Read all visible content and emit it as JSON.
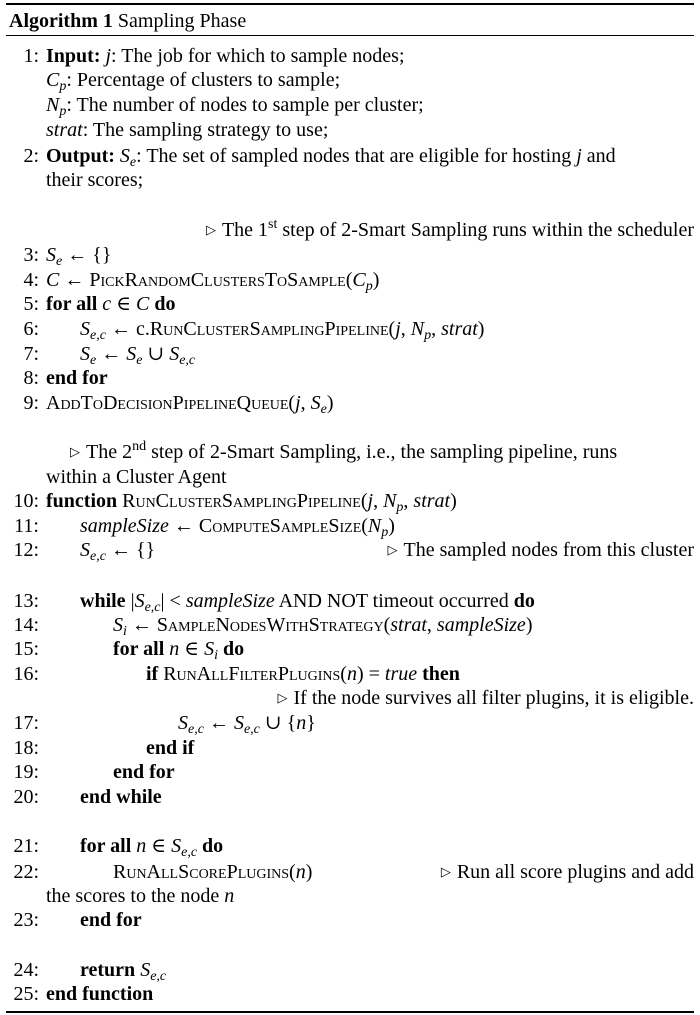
{
  "caption": {
    "label": "Algorithm 1",
    "title": "Sampling Phase"
  },
  "lines": [
    {
      "n": "1:",
      "k": "Input:",
      "t": " j: The job for which to sample nodes;"
    },
    {
      "t": "Cp: Percentage of clusters to sample;"
    },
    {
      "t": "Np: The number of nodes to sample per cluster;"
    },
    {
      "t": "strat: The sampling strategy to use;"
    },
    {
      "n": "2:",
      "k": "Output:",
      "t": " Se: The set of sampled nodes that are eligible for hosting j and"
    },
    {
      "t": "their scores;"
    },
    {
      "c": "The 1st step of 2-Smart Sampling runs within the scheduler"
    },
    {
      "n": "3:",
      "t": "Se ← {}"
    },
    {
      "n": "4:",
      "t": "C ← PickRandomClustersToSample(Cp)"
    },
    {
      "n": "5:",
      "t": "for all c ∈ C do"
    },
    {
      "n": "6:",
      "t": "Se,c ← c.RunClusterSamplingPipeline(j, Np, strat)"
    },
    {
      "n": "7:",
      "t": "Se ← Se ∪ Se,c"
    },
    {
      "n": "8:",
      "t": "end for"
    },
    {
      "n": "9:",
      "t": "AddToDecisionPipelineQueue(j, Se)"
    },
    {
      "c": "The 2nd step of 2-Smart Sampling, i.e., the sampling pipeline, runs"
    },
    {
      "t": "within a Cluster Agent"
    },
    {
      "n": "10:",
      "t": "function RunClusterSamplingPipeline(j, Np, strat)"
    },
    {
      "n": "11:",
      "t": "sampleSize ← ComputeSampleSize(Np)"
    },
    {
      "n": "12:",
      "t": "Se,c ← {}",
      "c": "The sampled nodes from this cluster"
    },
    {
      "n": "13:",
      "t": "while |Se,c| < sampleSize AND NOT timeout occurred do"
    },
    {
      "n": "14:",
      "t": "Si ← SampleNodesWithStrategy(strat, sampleSize)"
    },
    {
      "n": "15:",
      "t": "for all n ∈ Si do"
    },
    {
      "n": "16:",
      "t": "if RunAllFilterPlugins(n) = true then"
    },
    {
      "c": "If the node survives all filter plugins, it is eligible."
    },
    {
      "n": "17:",
      "t": "Se,c ← Se,c ∪ {n}"
    },
    {
      "n": "18:",
      "t": "end if"
    },
    {
      "n": "19:",
      "t": "end for"
    },
    {
      "n": "20:",
      "t": "end while"
    },
    {
      "n": "21:",
      "t": "for all n ∈ Se,c do"
    },
    {
      "n": "22:",
      "t": "RunAllScorePlugins(n)",
      "c": "Run all score plugins and add"
    },
    {
      "t": "the scores to the node n"
    },
    {
      "n": "23:",
      "t": "end for"
    },
    {
      "n": "24:",
      "t": "return Se,c"
    },
    {
      "n": "25:",
      "t": "end function"
    }
  ]
}
